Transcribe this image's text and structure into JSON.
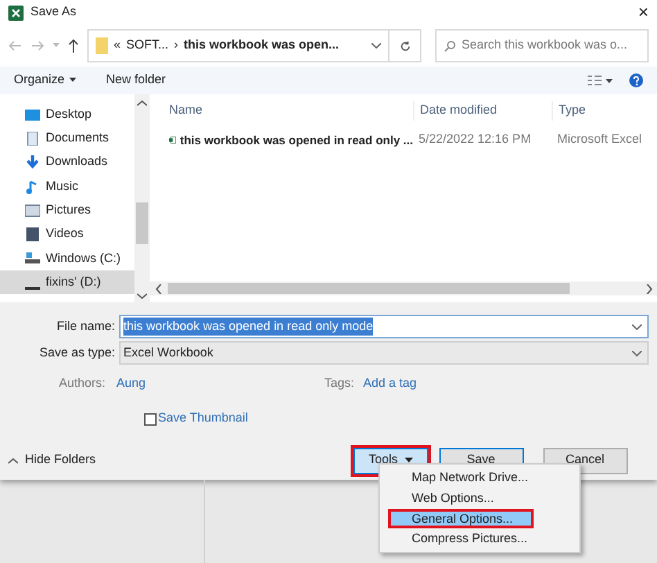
{
  "window": {
    "title": "Save As",
    "close": "×"
  },
  "address_bar": {
    "prefix": "«",
    "separator": "›",
    "path": [
      "SOFT...",
      "this workbook was open..."
    ]
  },
  "search": {
    "placeholder": "Search this workbook was o..."
  },
  "toolbar": {
    "organize": "Organize",
    "new_folder": "New folder"
  },
  "sidebar": {
    "items": [
      {
        "label": "Desktop",
        "selected": false
      },
      {
        "label": "Documents",
        "selected": false
      },
      {
        "label": "Downloads",
        "selected": false
      },
      {
        "label": "Music",
        "selected": false
      },
      {
        "label": "Pictures",
        "selected": false
      },
      {
        "label": "Videos",
        "selected": false
      },
      {
        "label": "Windows (C:)",
        "selected": false
      },
      {
        "label": "fixins' (D:)",
        "selected": true
      }
    ]
  },
  "file_list": {
    "columns": [
      "Name",
      "Date modified",
      "Type"
    ],
    "rows": [
      {
        "name": "this workbook was opened in read only ...",
        "date": "5/22/2022 12:16 PM",
        "type": "Microsoft Excel"
      }
    ]
  },
  "form": {
    "file_name_label": "File name:",
    "file_name": "this workbook was opened in read only mode",
    "save_as_type_label": "Save as type:",
    "save_as_type": "Excel Workbook",
    "authors_label": "Authors:",
    "authors": "Aung",
    "tags_label": "Tags:",
    "tags": "Add a tag",
    "save_thumbnail": {
      "label": "Save Thumbnail",
      "checked": false
    }
  },
  "footer": {
    "hide_folders": "Hide Folders",
    "tools": {
      "label": "Tools",
      "highlighted": true
    },
    "save": "Save",
    "cancel": "Cancel"
  },
  "tools_menu": [
    {
      "label": "Map Network Drive...",
      "selected": false,
      "highlighted": false
    },
    {
      "label": "Web Options...",
      "selected": false,
      "highlighted": false
    },
    {
      "label": "General Options...",
      "selected": true,
      "highlighted": true
    },
    {
      "label": "Compress Pictures...",
      "selected": false,
      "highlighted": false
    }
  ]
}
